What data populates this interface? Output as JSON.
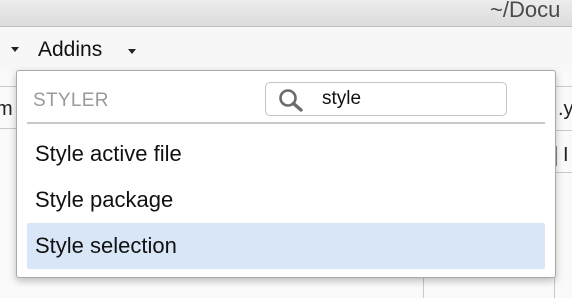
{
  "window": {
    "title": "~/Docu"
  },
  "toolbar": {
    "addins_label": "Addins"
  },
  "background": {
    "left_fragment": "m",
    "right_fragment": ".y",
    "right_fragment_2": "I"
  },
  "addin_popup": {
    "section_title": "STYLER",
    "search": {
      "value": "style",
      "icon": "search-icon"
    },
    "items": [
      {
        "label": "Style active file",
        "selected": false
      },
      {
        "label": "Style package",
        "selected": false
      },
      {
        "label": "Style selection",
        "selected": true
      }
    ],
    "colors": {
      "selected_background": "#d8e6f7",
      "section_title": "#9a9a9a",
      "border": "#a9a9a9"
    }
  }
}
